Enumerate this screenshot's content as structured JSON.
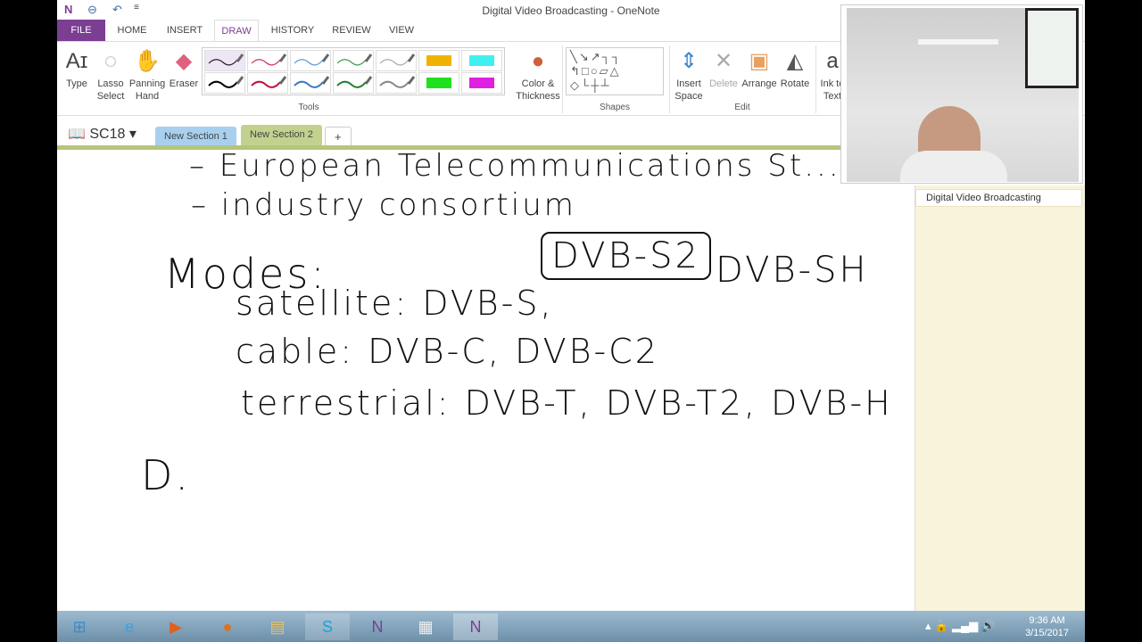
{
  "window": {
    "title": "Digital Video Broadcasting - OneNote"
  },
  "ribbon_tabs": [
    "FILE",
    "HOME",
    "INSERT",
    "DRAW",
    "HISTORY",
    "REVIEW",
    "VIEW"
  ],
  "active_tab": "DRAW",
  "tools": {
    "type": "Type",
    "lasso": "Lasso Select",
    "panning": "Panning Hand",
    "eraser": "Eraser",
    "color": "Color & Thickness",
    "group_tools": "Tools",
    "group_shapes": "Shapes",
    "insert_space": "Insert Space",
    "delete": "Delete",
    "arrange": "Arrange",
    "rotate": "Rotate",
    "ink": "Ink to Text",
    "group_edit": "Edit"
  },
  "pens": [
    {
      "color": "#222222"
    },
    {
      "color": "#d0305a"
    },
    {
      "color": "#5b9bd5"
    },
    {
      "color": "#3a9a4a"
    },
    {
      "color": "#aaaaaa"
    },
    {
      "color": "#f0b400",
      "highlighter": true
    },
    {
      "color": "#40f0f0",
      "highlighter": true
    },
    {
      "color": "#000000"
    },
    {
      "color": "#c0103a"
    },
    {
      "color": "#3a7ac0"
    },
    {
      "color": "#208030"
    },
    {
      "color": "#888888"
    },
    {
      "color": "#20e020",
      "highlighter": true
    },
    {
      "color": "#e020e0",
      "highlighter": true
    }
  ],
  "notebook": {
    "name": "SC18",
    "sections": [
      {
        "label": "New Section 1",
        "color": "#a8d0ee"
      },
      {
        "label": "New Section 2",
        "color": "#c2d18e",
        "active": true
      }
    ],
    "add": "+"
  },
  "page_list": {
    "items": [
      "Digital Video Broadcasting"
    ]
  },
  "notes": [
    "– European Telecommunications St...",
    "– industry consortium",
    "Modes:",
    "satellite: DVB-S,",
    "DVB-S2",
    "DVB-SH",
    "cable: DVB-C, DVB-C2",
    "terrestrial: DVB-T, DVB-T2, DVB-H",
    "D."
  ],
  "taskbar": {
    "time": "9:36 AM",
    "date": "3/15/2017"
  }
}
